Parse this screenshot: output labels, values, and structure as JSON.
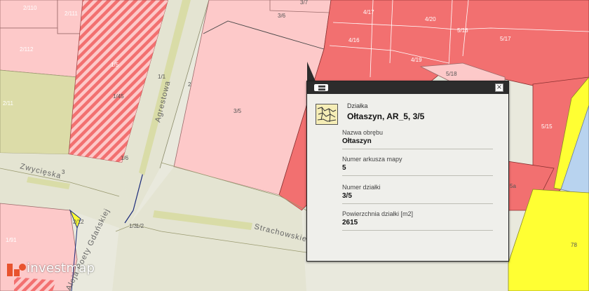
{
  "map": {
    "parcel_labels": [
      "2/110",
      "2/111",
      "3/7",
      "3/6",
      "4/17",
      "4/20",
      "5/16",
      "5/17",
      "4/16",
      "4/19",
      "5/18",
      "2/112",
      "1/5",
      "1/45",
      "1/1",
      "2",
      "2/11",
      "3/5",
      "1/6",
      "3",
      "5/15",
      "2/12",
      "1/91",
      "1/3",
      "1/2",
      "78",
      "5a"
    ],
    "streets": [
      "Agrestowa",
      "Zwycięska",
      "Strachowskiego",
      "Aleja Poety Gdańskiej"
    ]
  },
  "popup": {
    "type_label": "Działka",
    "title": "Ołtaszyn, AR_5, 3/5",
    "fields": [
      {
        "label": "Nazwa obrębu",
        "value": "Ołtaszyn"
      },
      {
        "label": "Numer arkusza mapy",
        "value": "5"
      },
      {
        "label": "Numer działki",
        "value": "3/5"
      },
      {
        "label": "Powierzchnia działki [m2]",
        "value": "2615"
      }
    ],
    "close_glyph": "×"
  },
  "logo": {
    "text": "investmap"
  },
  "colors": {
    "red_parcel": "#f27070",
    "pink_parcel": "#fdc9c9",
    "yellow_parcel": "#ffff33",
    "blue_parcel": "#b8d3ef",
    "road": "#e4e4d2",
    "green_strip": "#d9dca7"
  }
}
